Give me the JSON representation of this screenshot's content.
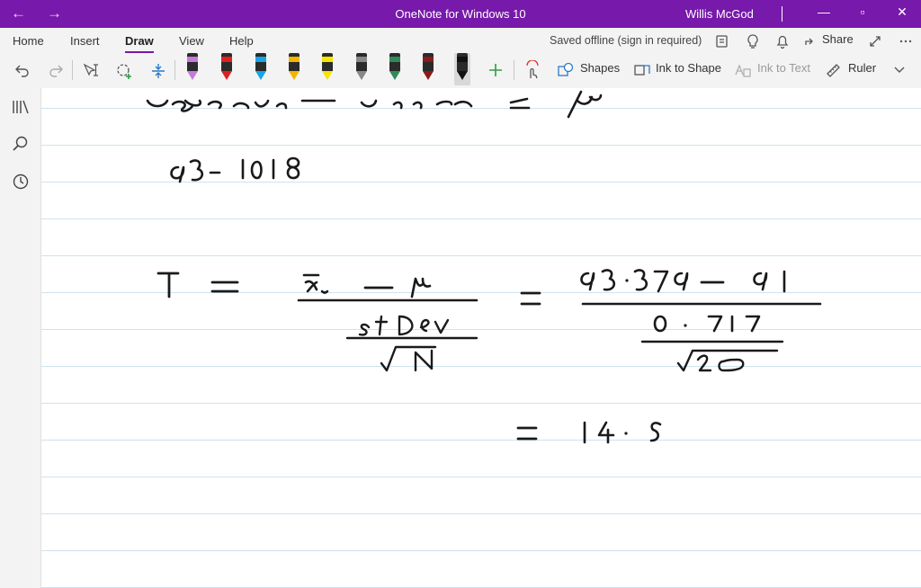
{
  "titlebar": {
    "back_icon": "←",
    "forward_icon": "→",
    "title": "OneNote for Windows 10",
    "user": "Willis McGod",
    "minimize_icon": "—",
    "maximize_icon": "▫",
    "close_icon": "✕",
    "color": "#7719aa"
  },
  "ribbon": {
    "tabs": [
      "Home",
      "Insert",
      "Draw",
      "View",
      "Help"
    ],
    "active_tab": "Draw",
    "status": "Saved offline (sign in required)",
    "share_label": "Share",
    "tools": {
      "shapes": "Shapes",
      "ink_to_shape": "Ink to Shape",
      "ink_to_text": "Ink to Text",
      "ruler": "Ruler"
    },
    "pen_colors": [
      "#c47ad6",
      "#e02020",
      "#1aa3e8",
      "#f5b400",
      "#f7e400",
      "#888888",
      "#2e8b57",
      "#8b1a1a",
      "#111111"
    ]
  },
  "sidebar": {
    "icons": [
      "notebooks-icon",
      "search-icon",
      "recent-icon"
    ]
  }
}
